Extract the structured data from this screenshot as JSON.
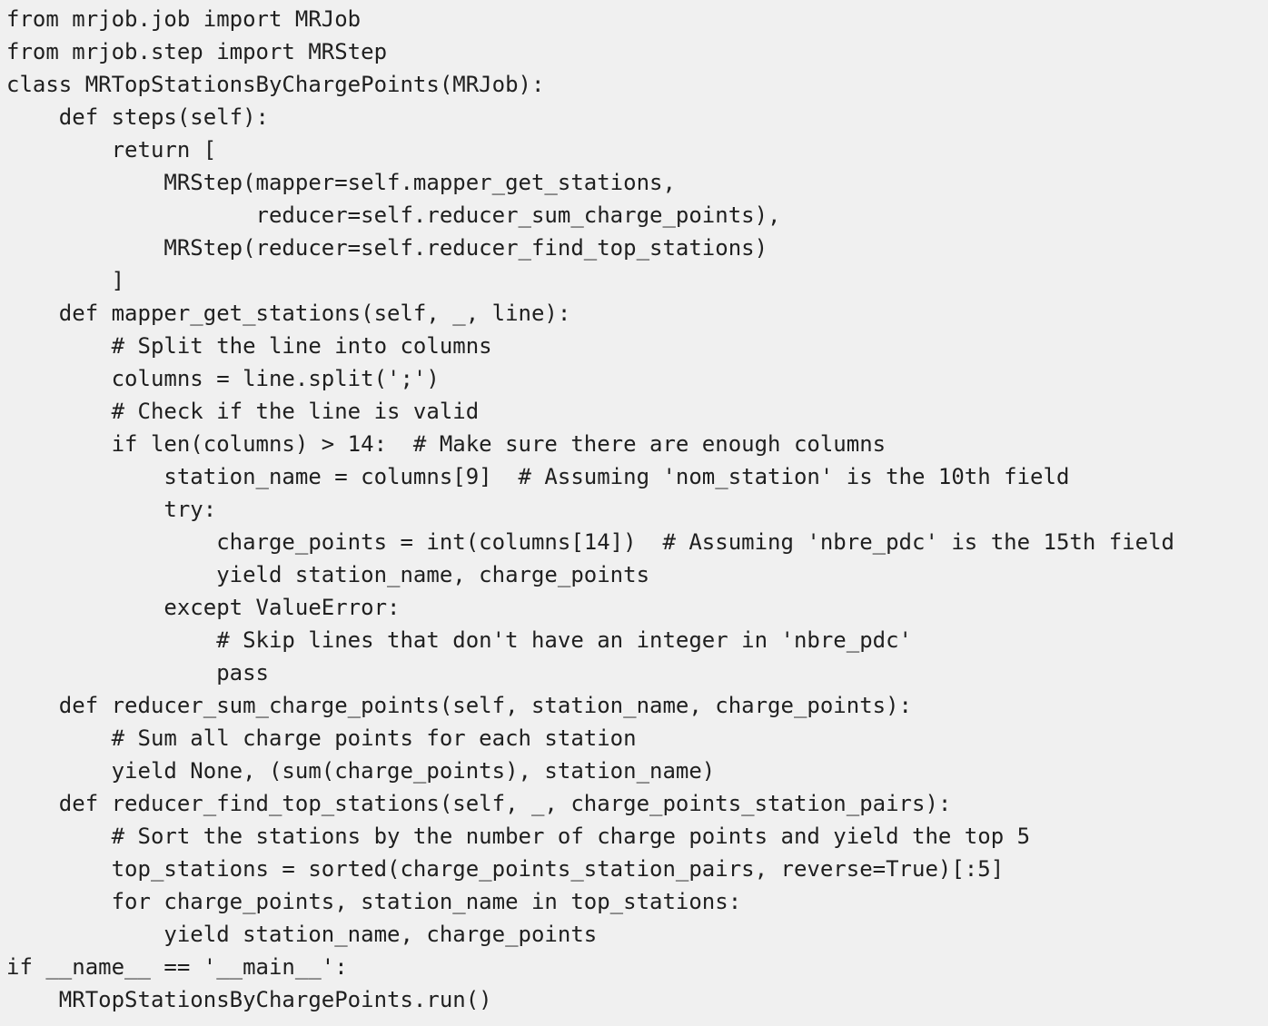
{
  "code": {
    "lines": [
      "from mrjob.job import MRJob",
      "from mrjob.step import MRStep",
      "class MRTopStationsByChargePoints(MRJob):",
      "    def steps(self):",
      "        return [",
      "            MRStep(mapper=self.mapper_get_stations,",
      "                   reducer=self.reducer_sum_charge_points),",
      "            MRStep(reducer=self.reducer_find_top_stations)",
      "        ]",
      "    def mapper_get_stations(self, _, line):",
      "        # Split the line into columns",
      "        columns = line.split(';')",
      "        # Check if the line is valid",
      "        if len(columns) > 14:  # Make sure there are enough columns",
      "            station_name = columns[9]  # Assuming 'nom_station' is the 10th field",
      "            try:",
      "                charge_points = int(columns[14])  # Assuming 'nbre_pdc' is the 15th field",
      "                yield station_name, charge_points",
      "            except ValueError:",
      "                # Skip lines that don't have an integer in 'nbre_pdc'",
      "                pass",
      "    def reducer_sum_charge_points(self, station_name, charge_points):",
      "        # Sum all charge points for each station",
      "        yield None, (sum(charge_points), station_name)",
      "    def reducer_find_top_stations(self, _, charge_points_station_pairs):",
      "        # Sort the stations by the number of charge points and yield the top 5",
      "        top_stations = sorted(charge_points_station_pairs, reverse=True)[:5]",
      "        for charge_points, station_name in top_stations:",
      "            yield station_name, charge_points",
      "if __name__ == '__main__':",
      "    MRTopStationsByChargePoints.run()"
    ]
  }
}
